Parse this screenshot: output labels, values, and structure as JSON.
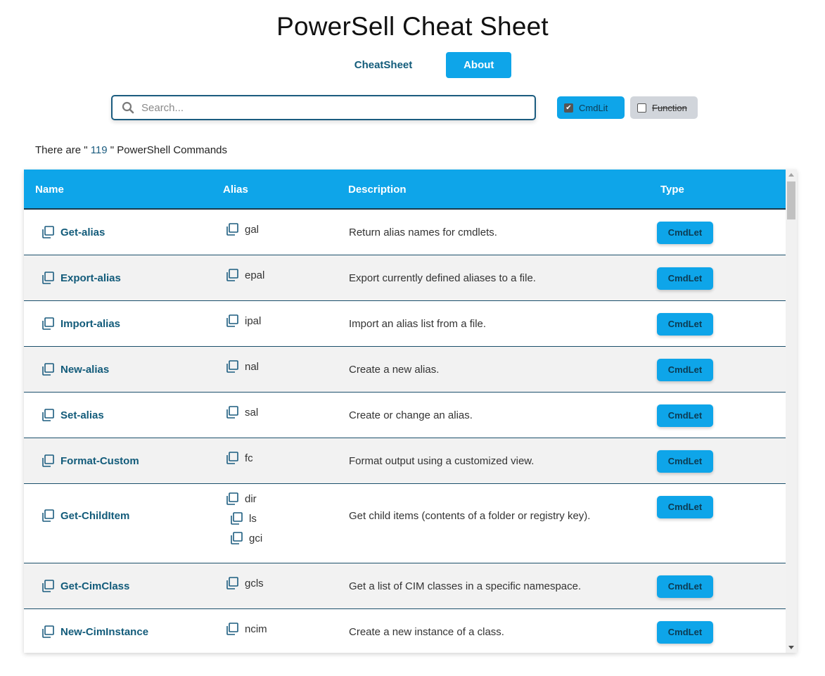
{
  "app": {
    "title": "PowerSell Cheat Sheet"
  },
  "nav": {
    "tabs": [
      {
        "label": "CheatSheet"
      },
      {
        "label": "About"
      }
    ]
  },
  "search": {
    "placeholder": "Search...",
    "value": ""
  },
  "filters": [
    {
      "label": "CmdLit",
      "checked": true
    },
    {
      "label": "Function",
      "checked": false
    }
  ],
  "count": {
    "prefix": "There are \"",
    "value": "119",
    "suffix": "\" PowerShell Commands"
  },
  "table": {
    "headers": {
      "name": "Name",
      "alias": "Alias",
      "description": "Description",
      "type": "Type"
    },
    "rows": [
      {
        "name": "Get-alias",
        "aliases": [
          "gal"
        ],
        "description": "Return alias names for cmdlets.",
        "type": "CmdLet"
      },
      {
        "name": "Export-alias",
        "aliases": [
          "epal"
        ],
        "description": "Export currently defined aliases to a file.",
        "type": "CmdLet"
      },
      {
        "name": "Import-alias",
        "aliases": [
          "ipal"
        ],
        "description": "Import an alias list from a file.",
        "type": "CmdLet"
      },
      {
        "name": "New-alias",
        "aliases": [
          "nal"
        ],
        "description": "Create a new alias.",
        "type": "CmdLet"
      },
      {
        "name": "Set-alias",
        "aliases": [
          "sal"
        ],
        "description": "Create or change an alias.",
        "type": "CmdLet"
      },
      {
        "name": "Format-Custom",
        "aliases": [
          "fc"
        ],
        "description": "Format output using a customized view.",
        "type": "CmdLet"
      },
      {
        "name": "Get-ChildItem",
        "aliases": [
          "dir",
          "ls",
          "gci"
        ],
        "description": "Get child items (contents of a folder or registry key).",
        "type": "CmdLet"
      },
      {
        "name": "Get-CimClass",
        "aliases": [
          "gcls"
        ],
        "description": "Get a list of CIM classes in a specific namespace.",
        "type": "CmdLet"
      },
      {
        "name": "New-CimInstance",
        "aliases": [
          "ncim"
        ],
        "description": "Create a new instance of a class.",
        "type": "CmdLet"
      }
    ]
  },
  "icons": {
    "copy": "copy-icon",
    "search": "search-icon",
    "checkbox": "checkbox-icon"
  },
  "colors": {
    "accent": "#0ea5e9",
    "text_link": "#125b7a",
    "border": "#1b5c7f"
  }
}
